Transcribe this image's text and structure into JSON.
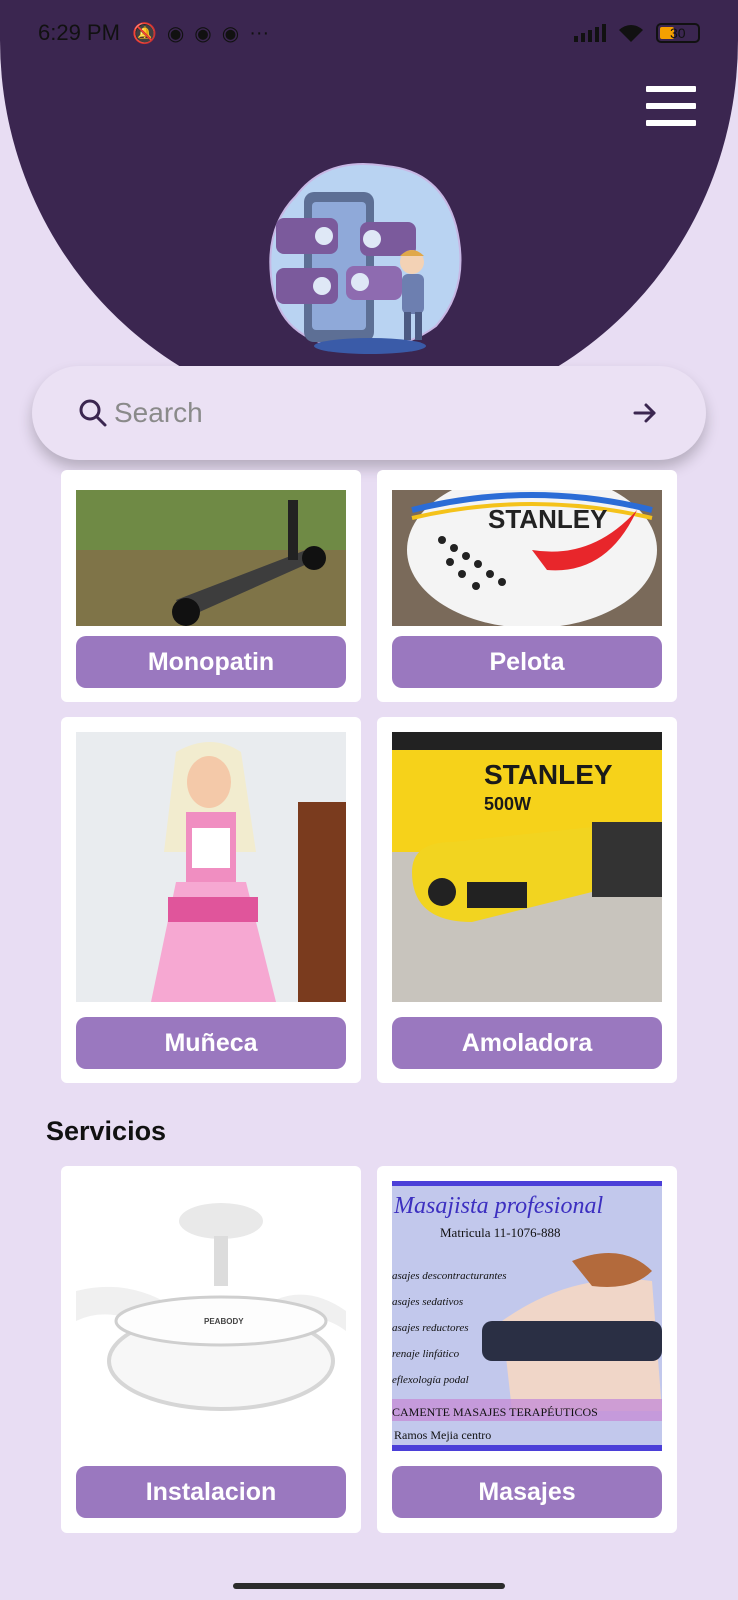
{
  "status_bar": {
    "time": "6:29 PM",
    "more": "···",
    "battery": "30"
  },
  "search": {
    "placeholder": "Search"
  },
  "products": [
    {
      "label": "Monopatin"
    },
    {
      "label": "Pelota"
    },
    {
      "label": "Muñeca"
    },
    {
      "label": "Amoladora"
    }
  ],
  "services_section": {
    "title": "Servicios"
  },
  "services": [
    {
      "label": "Instalacion"
    },
    {
      "label": "Masajes"
    }
  ],
  "ball_image": {
    "brand": "STANLEY"
  },
  "grinder_image": {
    "brand": "STANLEY",
    "power": "500W"
  },
  "fan_image": {
    "brand": "PEABODY"
  },
  "massage_flyer": {
    "title": "Masajista profesional",
    "matricula": "Matricula 11-1076-888",
    "lines": [
      "asajes descontracturantes",
      "asajes sedativos",
      "asajes reductores",
      "renaje linfático",
      "eflexología podal"
    ],
    "footer": "CAMENTE MASAJES TERAPÉUTICOS",
    "location": "Ramos Mejia centro"
  },
  "colors": {
    "header": "#3b2650",
    "background": "#e8ddf3",
    "button": "#9a78bf",
    "search_bg": "#ebe1f4"
  }
}
